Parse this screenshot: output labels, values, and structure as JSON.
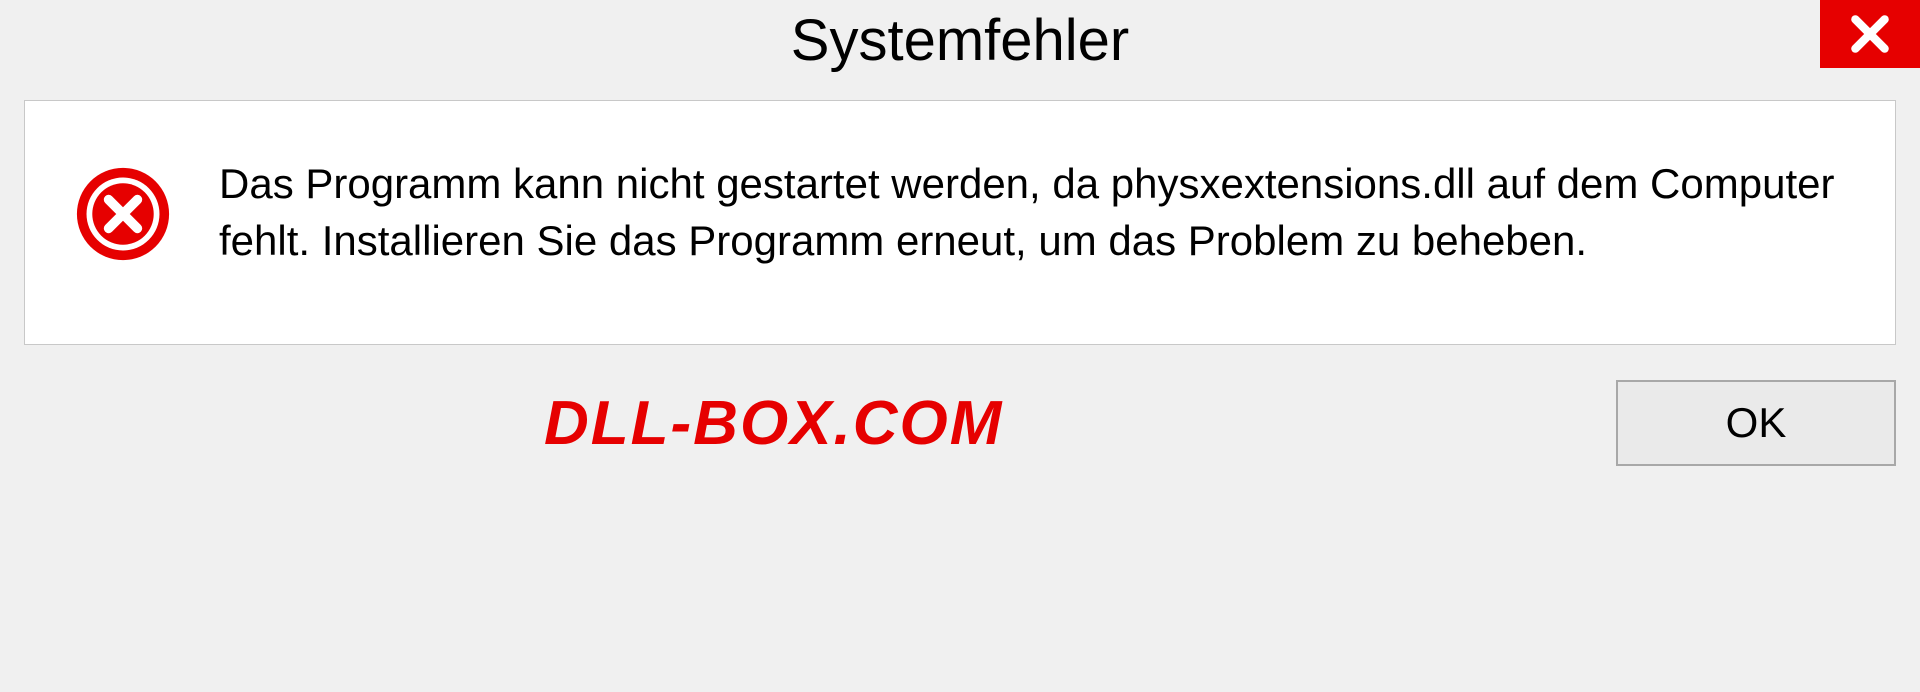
{
  "dialog": {
    "title": "Systemfehler",
    "message": "Das Programm kann nicht gestartet werden, da physxextensions.dll auf dem Computer fehlt. Installieren Sie das Programm erneut, um das Problem zu beheben.",
    "ok_label": "OK"
  },
  "watermark": "DLL-BOX.COM"
}
